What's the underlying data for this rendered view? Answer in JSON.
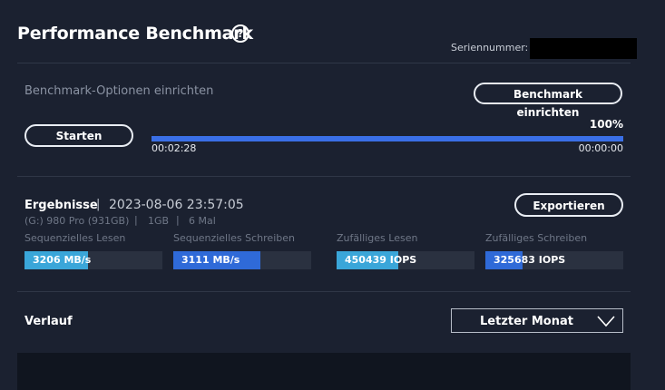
{
  "header": {
    "title": "Performance Benchmark",
    "help_glyph": "?",
    "serial_label": "Seriennummer:"
  },
  "setup": {
    "label": "Benchmark-Optionen einrichten",
    "button": "Benchmark einrichten"
  },
  "run": {
    "start_button": "Starten",
    "progress_percent": "100%",
    "progress_value": 1.0,
    "elapsed": "00:02:28",
    "remaining": "00:00:00"
  },
  "results": {
    "title": "Ergebnisse",
    "separator": "|",
    "date": "2023-08-06 23:57:05",
    "drive": "(G:) 980 Pro (931GB)",
    "size": "1GB",
    "runs": "6 Mal",
    "export_button": "Exportieren",
    "metrics": [
      {
        "label": "Sequenzielles Lesen",
        "value": "3206 MB/s",
        "fill": 0.46,
        "color": "#3aa6d9"
      },
      {
        "label": "Sequenzielles Schreiben",
        "value": "3111 MB/s",
        "fill": 0.63,
        "color": "#2f6ad8"
      },
      {
        "label": "Zufälliges Lesen",
        "value": "450439 IOPS",
        "fill": 0.45,
        "color": "#3aa6d9"
      },
      {
        "label": "Zufälliges Schreiben",
        "value": "325683 IOPS",
        "fill": 0.27,
        "color": "#2f6ad8"
      }
    ]
  },
  "history": {
    "title": "Verlauf",
    "range_selected": "Letzter Monat"
  },
  "colors": {
    "background": "#1b2130",
    "progress": "#3a6fe6",
    "bottom_panel": "#10151f"
  }
}
